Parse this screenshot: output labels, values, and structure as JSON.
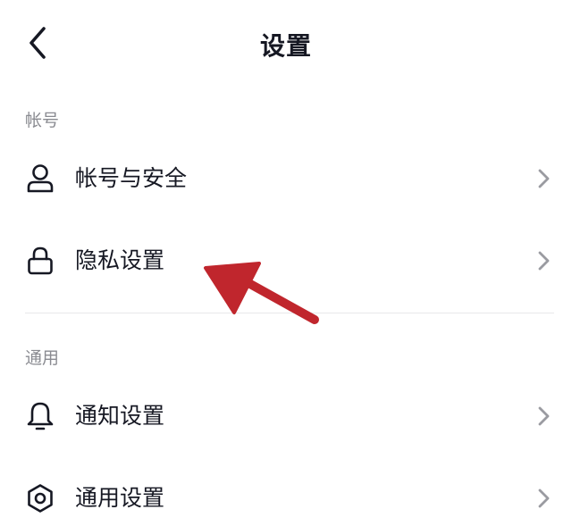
{
  "nav": {
    "title": "设置",
    "back_icon": "chevron-left-icon"
  },
  "sections": [
    {
      "header": "帐号",
      "items": [
        {
          "label": "帐号与安全",
          "icon": "user-icon"
        },
        {
          "label": "隐私设置",
          "icon": "lock-icon"
        }
      ]
    },
    {
      "header": "通用",
      "items": [
        {
          "label": "通知设置",
          "icon": "bell-icon"
        },
        {
          "label": "通用设置",
          "icon": "gear-icon"
        }
      ]
    }
  ],
  "colors": {
    "text": "#161823",
    "secondary_text": "#8a8b91",
    "chevron": "#9a9ba1",
    "divider": "#e8e8ea",
    "annotation_arrow": "#c0262d"
  },
  "annotation": {
    "type": "arrow",
    "points_to": "隐私设置"
  }
}
